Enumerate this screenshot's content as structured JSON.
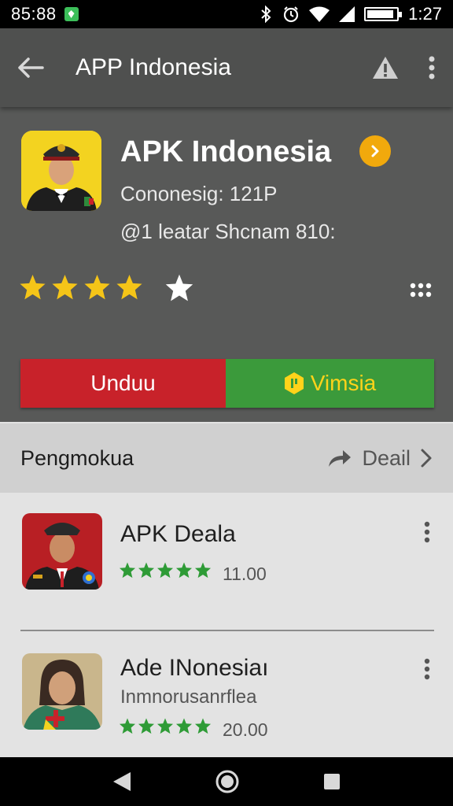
{
  "status_bar": {
    "time": "85:88",
    "clock": "1:27",
    "icons": [
      "notification-icon",
      "bluetooth-icon",
      "alarm-icon",
      "wifi-icon",
      "signal-icon",
      "battery-icon"
    ]
  },
  "app_bar": {
    "title": "APP Indonesia",
    "icons": [
      "back-arrow-icon",
      "warning-icon",
      "overflow-menu-icon"
    ]
  },
  "hero": {
    "title": "APK Indonesia",
    "subtitle_1": "Cononesig: 121P",
    "subtitle_2": "@1 leatar Shcnam 810:",
    "rating": 4,
    "rating_max": 5,
    "download_label": "Unduu",
    "version_label": "Vimsia"
  },
  "section": {
    "title": "Pengmokua",
    "action_label": "Deail"
  },
  "list": [
    {
      "title": "APK Deala",
      "subtitle": "",
      "rating": 5,
      "value": "11.00"
    },
    {
      "title": "Ade INonesiaı",
      "subtitle": "Inmnorusanrflea",
      "rating": 5,
      "value": "20.00"
    }
  ],
  "colors": {
    "app_bar": "#4f504f",
    "hero": "#585958",
    "star": "#f5c518",
    "download": "#c8222a",
    "version": "#3b9a3b",
    "list_star": "#2e9b36"
  },
  "nav_bar": {
    "icons": [
      "back-triangle-icon",
      "home-circle-icon",
      "recents-square-icon"
    ]
  }
}
